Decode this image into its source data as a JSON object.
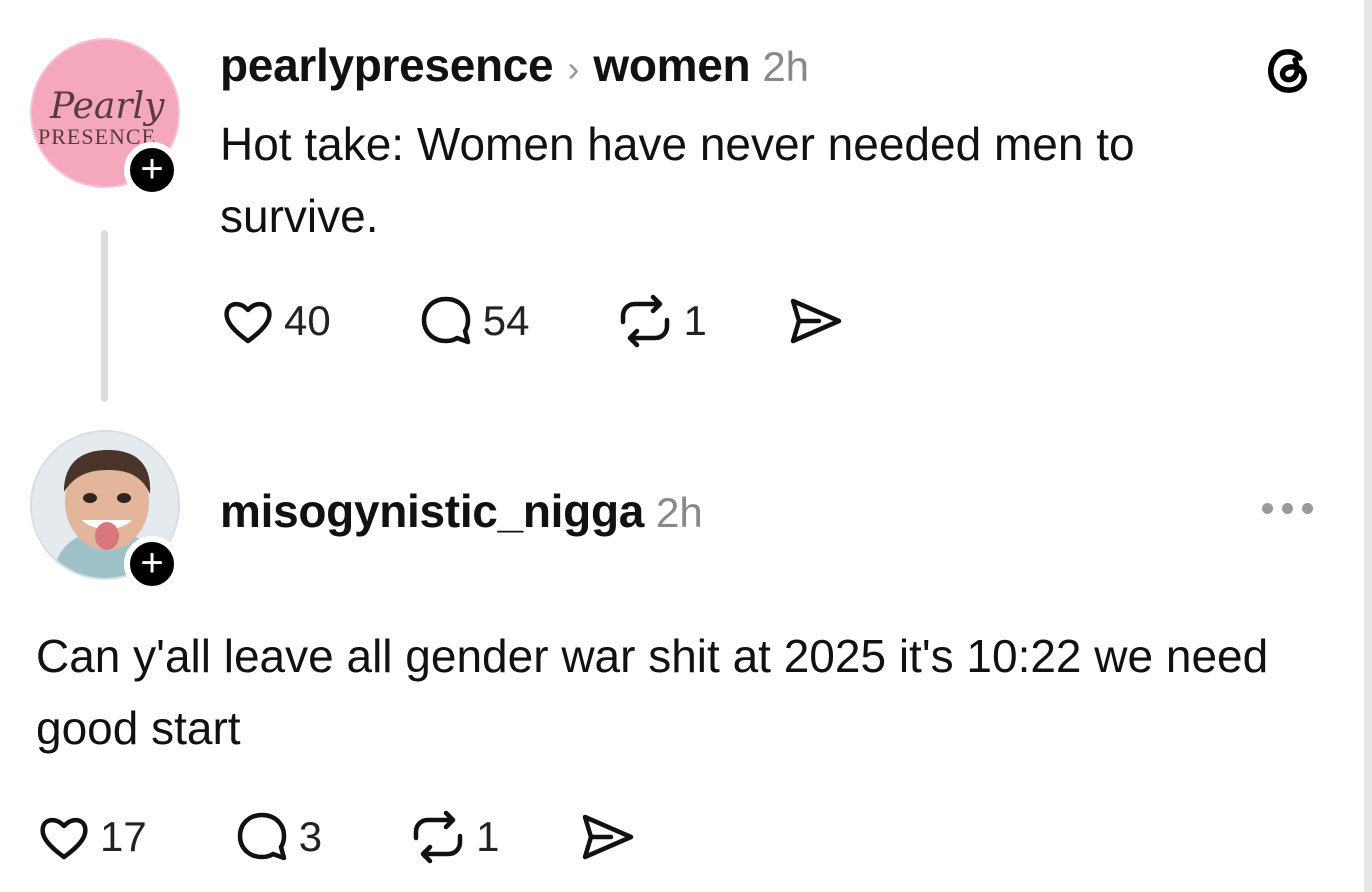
{
  "post": {
    "author": "pearlypresence",
    "community": "women",
    "time": "2h",
    "text": "Hot take: Women have never needed men to survive.",
    "likes": "40",
    "replies": "54",
    "reposts": "1",
    "logo_text_1": "Pearly",
    "logo_text_2": "PRESENCE"
  },
  "reply": {
    "author": "misogynistic_nigga",
    "time": "2h",
    "text": "Can y'all leave all gender war shit at 2025 it's 10:22 we need good start",
    "likes": "17",
    "replies": "3",
    "reposts": "1"
  },
  "icons": {
    "chevron": "›",
    "plus": "+"
  }
}
